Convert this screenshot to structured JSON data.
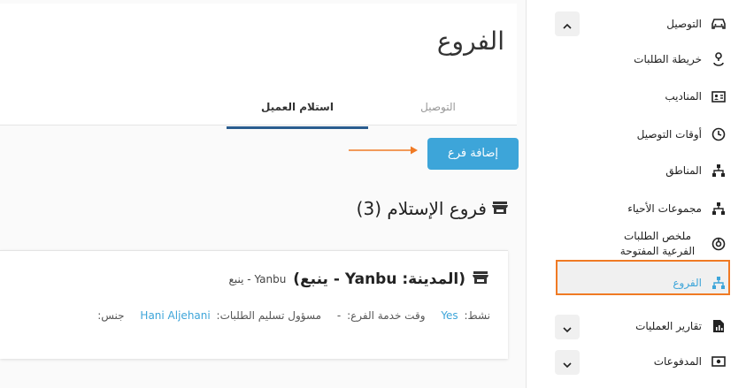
{
  "page": {
    "title": "الفروع"
  },
  "tabs": [
    {
      "label": "التوصيل",
      "active": false
    },
    {
      "label": "استلام العميل",
      "active": true
    }
  ],
  "actions": {
    "add_branch": "إضافة فرع"
  },
  "section": {
    "title": "فروع الإستلام (3)"
  },
  "branch": {
    "name": "(المدينة: Yanbu - ينبع)",
    "subtitle": "Yanbu - ينبع",
    "active_label": "نشط:",
    "active_value": "Yes",
    "service_time_label": "وقت خدمة الفرع:",
    "service_time_value": "-",
    "receiver_label": "مسؤول تسليم الطلبات:",
    "receiver_value": "Hani Aljehani",
    "gender_label": "جنس:"
  },
  "sidebar": {
    "items": [
      {
        "label": "التوصيل",
        "icon": "car-icon",
        "chevron": "up"
      },
      {
        "label": "خريطة الطلبات",
        "icon": "map-pin-route-icon"
      },
      {
        "label": "المناديب",
        "icon": "id-card-icon"
      },
      {
        "label": "أوقات التوصيل",
        "icon": "clock-icon"
      },
      {
        "label": "المناطق",
        "icon": "sitemap-icon"
      },
      {
        "label": "مجموعات الأحياء",
        "icon": "sitemap-icon"
      },
      {
        "label": "ملخص الطلبات الفرعية المفتوحة",
        "icon": "donut-chart-icon"
      },
      {
        "label": "الفروع",
        "icon": "sitemap-icon",
        "active": true
      },
      {
        "label": "تقارير العمليات",
        "icon": "report-icon",
        "chevron": "down"
      },
      {
        "label": "المدفوعات",
        "icon": "money-icon",
        "chevron": "down"
      }
    ]
  },
  "colors": {
    "accent": "#3da5d9",
    "highlight": "#f07a24",
    "tab_underline": "#2a5d8f"
  }
}
